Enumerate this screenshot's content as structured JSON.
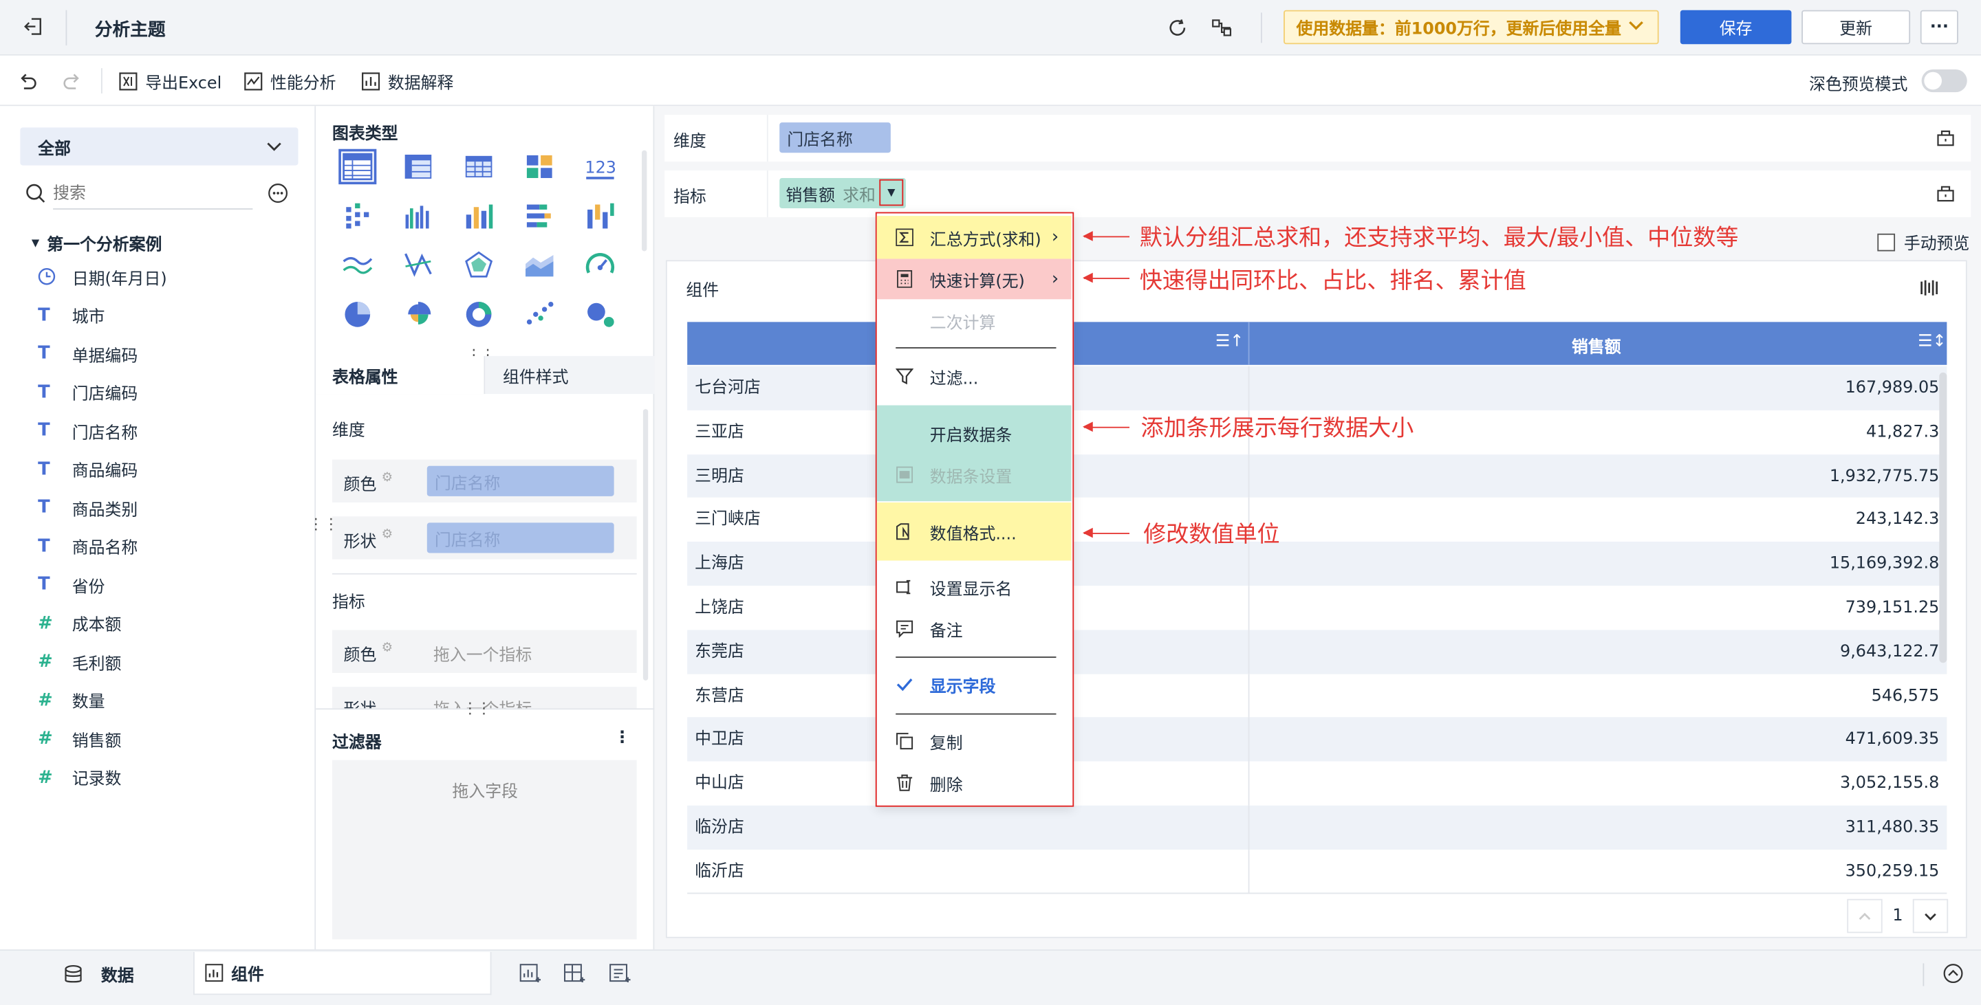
{
  "topbar": {
    "title": "分析主题",
    "notice": "使用数据量：前1000万行，更新后使用全量",
    "save": "保存",
    "update": "更新",
    "more": "···"
  },
  "toolbar": {
    "export": "导出Excel",
    "perf": "性能分析",
    "explain": "数据解释",
    "dark_mode": "深色预览模式"
  },
  "left": {
    "selector": "全部",
    "search_placeholder": "搜索",
    "group": "第一个分析案例",
    "fields": [
      {
        "label": "日期(年月日)",
        "type": "date"
      },
      {
        "label": "城市",
        "type": "text"
      },
      {
        "label": "单据编码",
        "type": "text"
      },
      {
        "label": "门店编码",
        "type": "text"
      },
      {
        "label": "门店名称",
        "type": "text"
      },
      {
        "label": "商品编码",
        "type": "text"
      },
      {
        "label": "商品类别",
        "type": "text"
      },
      {
        "label": "商品名称",
        "type": "text"
      },
      {
        "label": "省份",
        "type": "text"
      },
      {
        "label": "成本额",
        "type": "number"
      },
      {
        "label": "毛利额",
        "type": "number"
      },
      {
        "label": "数量",
        "type": "number"
      },
      {
        "label": "销售额",
        "type": "number"
      },
      {
        "label": "记录数",
        "type": "number"
      }
    ]
  },
  "mid": {
    "chart_type_title": "图表类型",
    "tab_table": "表格属性",
    "tab_style": "组件样式",
    "dimension_title": "维度",
    "color_label": "颜色",
    "shape_label": "形状",
    "dim_pill": "门店名称",
    "measure_title": "指标",
    "measure_placeholder": "拖入一个指标",
    "filter_title": "过滤器",
    "filter_placeholder": "拖入字段",
    "chart_icon_123": "123"
  },
  "right": {
    "dimension_label": "维度",
    "dimension_pill": "门店名称",
    "measure_label": "指标",
    "measure_pill_name": "销售额",
    "measure_pill_agg": "求和",
    "manual_preview": "手动预览",
    "component_title": "组件",
    "col2_header": "销售额",
    "rows": [
      {
        "store": "七台河店",
        "value": "167,989.05"
      },
      {
        "store": "三亚店",
        "value": "41,827.3"
      },
      {
        "store": "三明店",
        "value": "1,932,775.75"
      },
      {
        "store": "三门峡店",
        "value": "243,142.3"
      },
      {
        "store": "上海店",
        "value": "15,169,392.8"
      },
      {
        "store": "上饶店",
        "value": "739,151.25"
      },
      {
        "store": "东莞店",
        "value": "9,643,122.7"
      },
      {
        "store": "东营店",
        "value": "546,575"
      },
      {
        "store": "中卫店",
        "value": "471,609.35"
      },
      {
        "store": "中山店",
        "value": "3,052,155.8"
      },
      {
        "store": "临汾店",
        "value": "311,480.35"
      },
      {
        "store": "临沂店",
        "value": "350,259.15"
      }
    ],
    "page": "1"
  },
  "menu": {
    "agg": "汇总方式(求和)",
    "quick": "快速计算(无)",
    "second": "二次计算",
    "filter": "过滤...",
    "databar": "开启数据条",
    "databar_setting": "数据条设置",
    "format": "数值格式....",
    "display_name": "设置显示名",
    "note": "备注",
    "show_field": "显示字段",
    "copy": "复制",
    "delete": "删除"
  },
  "annotations": {
    "a1": "默认分组汇总求和，还支持求平均、最大/最小值、中位数等",
    "a2": "快速得出同环比、占比、排名、累计值",
    "a3": "添加条形展示每行数据大小",
    "a4": "修改数值单位"
  },
  "bottom": {
    "data_tab": "数据",
    "component_tab": "组件"
  },
  "colors": {
    "primary": "#2f6bd9",
    "highlight_yellow": "#fff7a6",
    "highlight_red": "#fbcaca",
    "highlight_teal": "#b7e4da",
    "annotation_red": "#e53935"
  }
}
